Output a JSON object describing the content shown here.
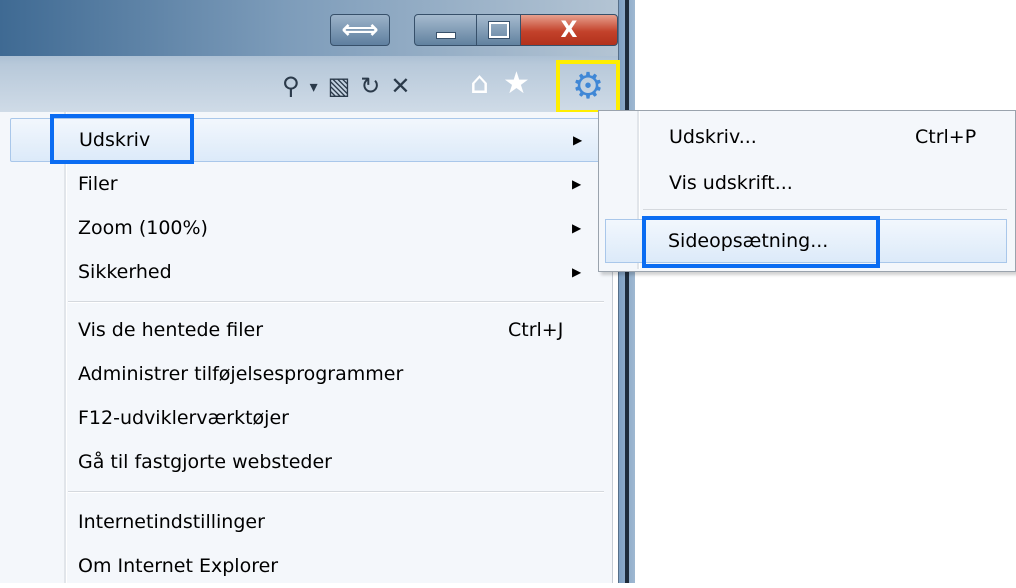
{
  "titlebar": {
    "close_label": "X",
    "restore_arrow_label": "⟺"
  },
  "toolbar": {
    "search_glyph": "⚲",
    "dropdown_glyph": "▾",
    "compat_glyph": "▧",
    "refresh_glyph": "↻",
    "stop_glyph": "✕",
    "home_glyph": "⌂",
    "favorites_glyph": "★",
    "tools_glyph": "⚙"
  },
  "menu": {
    "items": [
      {
        "label": "Udskriv",
        "arrow": "▶"
      },
      {
        "label": "Filer",
        "arrow": "▶"
      },
      {
        "label": "Zoom (100%)",
        "arrow": "▶"
      },
      {
        "label": "Sikkerhed",
        "arrow": "▶"
      },
      {
        "label": "Vis de hentede filer",
        "shortcut": "Ctrl+J"
      },
      {
        "label": "Administrer tilføjelsesprogrammer"
      },
      {
        "label": "F12-udviklerværktøjer"
      },
      {
        "label": "Gå til fastgjorte websteder"
      },
      {
        "label": "Internetindstillinger"
      },
      {
        "label": "Om Internet Explorer"
      }
    ]
  },
  "submenu": {
    "items": [
      {
        "label": "Udskriv...",
        "shortcut": "Ctrl+P"
      },
      {
        "label": "Vis udskrift..."
      },
      {
        "label": "Sideopsætning..."
      }
    ]
  },
  "colors": {
    "highlight_box_blue": "#0a6cf2",
    "highlight_box_yellow": "#ffee00",
    "close_red": "#c3422b"
  }
}
